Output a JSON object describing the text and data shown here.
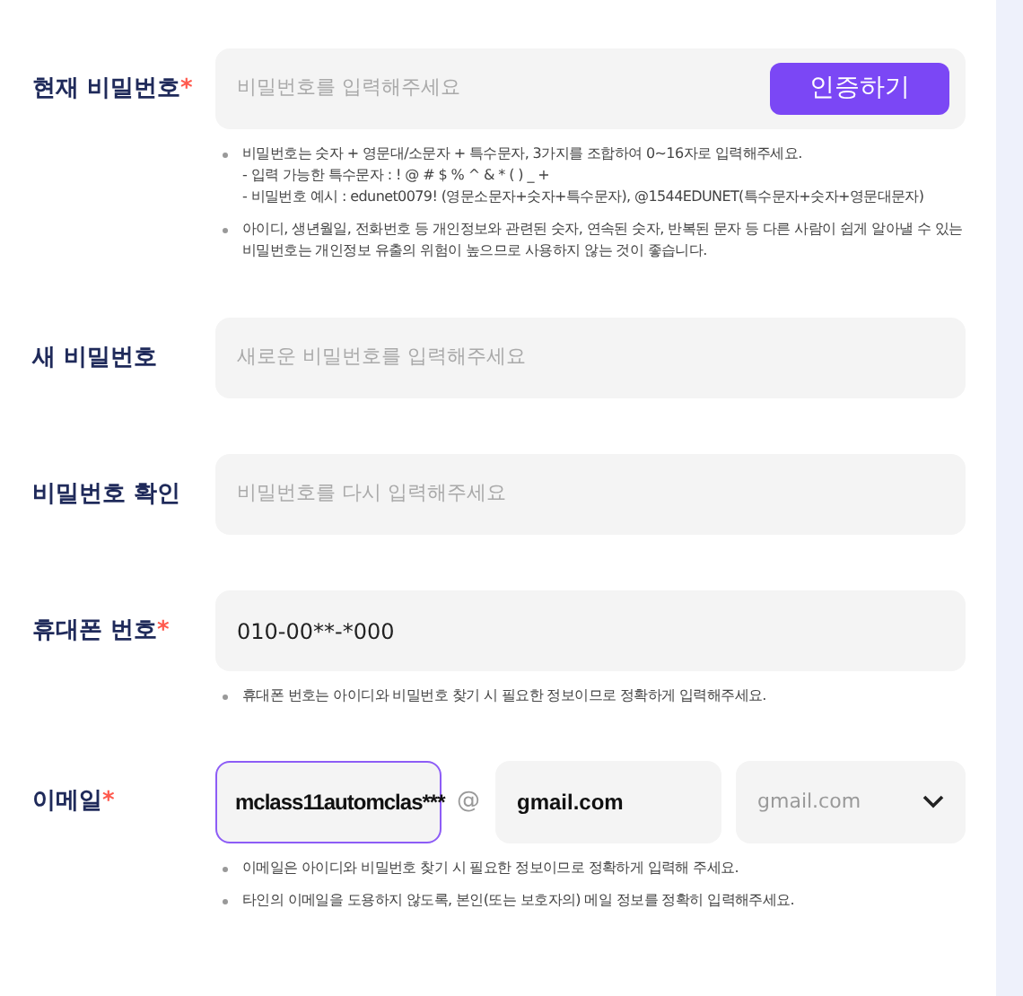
{
  "fields": [
    {
      "kind": "password",
      "label": "현재 비밀번호",
      "required_mark": "*",
      "placeholder": "비밀번호를 입력해주세요",
      "button": "인증하기",
      "notes": [
        "비밀번호는 숫자 + 영문대/소문자 + 특수문자, 3가지를 조합하여 0~16자로 입력해주세요.\n- 입력 가능한 특수문자 : ! @ # $ % ^ & * ( ) _ +\n- 비밀번호 예시 : edunet0079! (영문소문자+숫자+특수문자), @1544EDUNET(특수문자+숫자+영문대문자)",
        "아이디, 생년월일, 전화번호 등 개인정보와 관련된 숫자, 연속된 숫자, 반복된 문자 등 다른 사람이 쉽게 알아낼 수 있는 비밀번호는 개인정보 유출의 위험이 높으므로 사용하지 않는 것이 좋습니다."
      ]
    },
    {
      "kind": "password",
      "label": "새 비밀번호",
      "placeholder": "새로운 비밀번호를 입력해주세요"
    },
    {
      "kind": "password",
      "label": "비밀번호 확인",
      "placeholder": "비밀번호를 다시 입력해주세요"
    },
    {
      "kind": "text",
      "label": "휴대폰 번호",
      "required_mark": "*",
      "value": "010-00**-*000",
      "notes": [
        "휴대폰 번호는 아이디와 비밀번호 찾기 시 필요한 정보이므로 정확하게 입력해주세요."
      ]
    },
    {
      "kind": "email",
      "label": "이메일",
      "required_mark": "*",
      "value": "mclass11automclas***",
      "focused": true,
      "separator": "@",
      "domain": "gmail.com",
      "select": "gmail.com",
      "notes": [
        "이메일은 아이디와 비밀번호 찾기 시 필요한 정보이므로 정확하게 입력해 주세요.",
        "타인의 이메일을 도용하지 않도록, 본인(또는 보호자의) 메일 정보를 정확히 입력해주세요."
      ]
    }
  ]
}
